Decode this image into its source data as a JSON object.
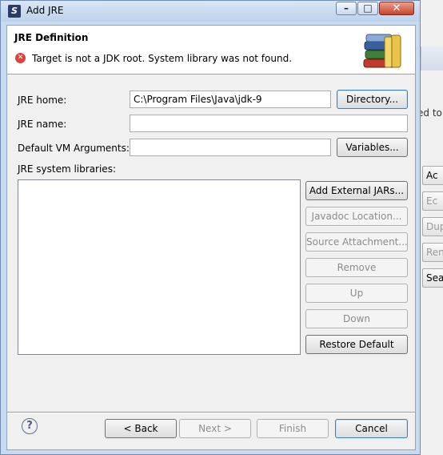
{
  "window": {
    "title": "Add JRE"
  },
  "header": {
    "title": "JRE Definition",
    "message": "Target is not a JDK root. System library was not found."
  },
  "form": {
    "jre_home_label": "JRE home:",
    "jre_home_value": "C:\\Program Files\\Java\\jdk-9",
    "directory_button": "Directory...",
    "jre_name_label": "JRE name:",
    "jre_name_value": "",
    "vm_args_label": "Default VM Arguments:",
    "vm_args_value": "",
    "variables_button": "Variables...",
    "libraries_label": "JRE system libraries:"
  },
  "library_buttons": {
    "add_external_jars": "Add External JARs...",
    "javadoc_location": "Javadoc Location...",
    "source_attachment": "Source Attachment...",
    "remove": "Remove",
    "up": "Up",
    "down": "Down",
    "restore_default": "Restore Default"
  },
  "footer": {
    "help": "?",
    "back": "< Back",
    "next": "Next >",
    "finish": "Finish",
    "cancel": "Cancel"
  },
  "background_fragments": {
    "text1": "ed to",
    "btn1": "Ac",
    "btn2": "Ec",
    "btn3": "Dupl",
    "btn4": "Ren",
    "btn5": "Sea"
  },
  "icons": [
    "app-icon",
    "minimize-icon",
    "maximize-icon",
    "close-icon",
    "error-icon",
    "library-books-icon",
    "help-icon"
  ]
}
